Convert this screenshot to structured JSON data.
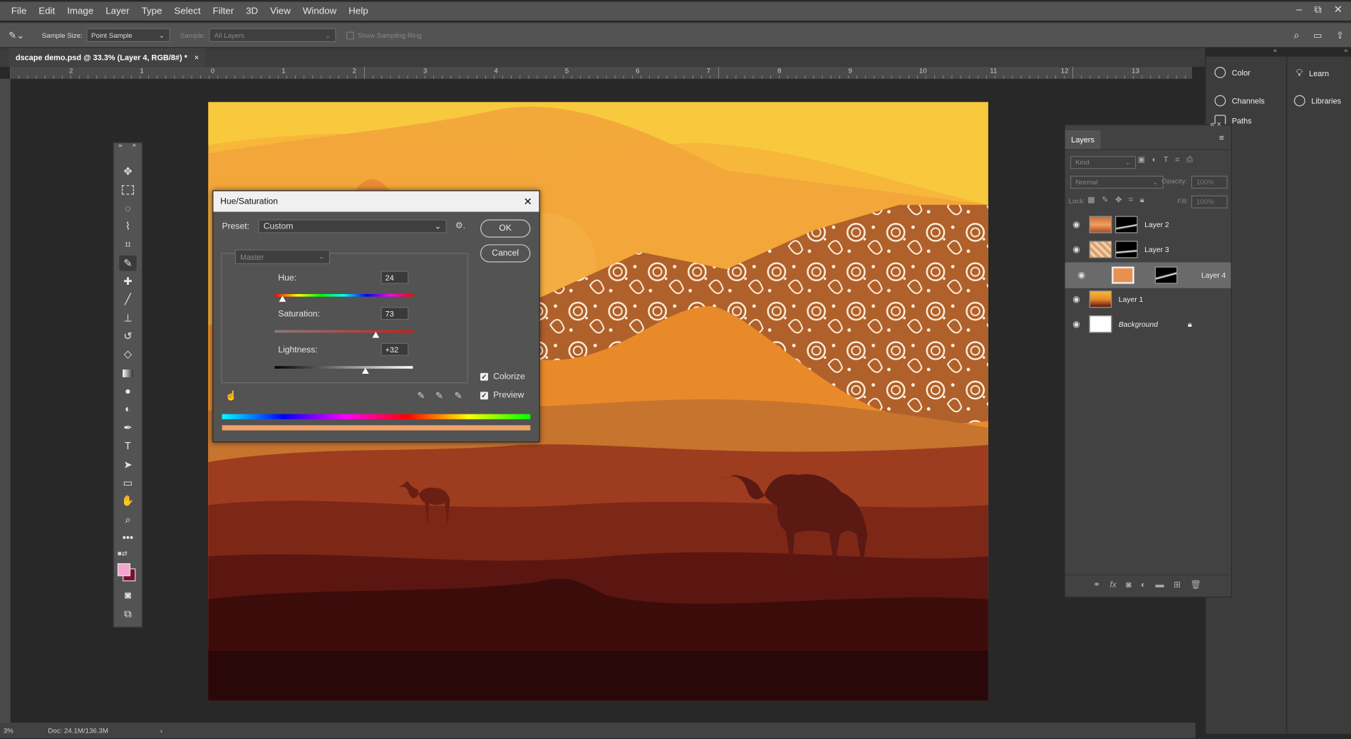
{
  "menu": [
    "File",
    "Edit",
    "Image",
    "Layer",
    "Type",
    "Select",
    "Filter",
    "3D",
    "View",
    "Window",
    "Help"
  ],
  "window_controls": {
    "minimize": "–",
    "restore": "⧉",
    "close": "✕"
  },
  "options_bar": {
    "sample_size_label": "Sample Size:",
    "sample_size_value": "Point Sample",
    "sample_label": "Sample:",
    "sample_value": "All Layers",
    "show_ring_label": "Show Sampling Ring"
  },
  "document_tab": {
    "title": "dscape demo.psd @ 33.3% (Layer 4, RGB/8#) *",
    "close": "×"
  },
  "ruler_labels": [
    "2",
    "1",
    "0",
    "1",
    "2",
    "3",
    "4",
    "5",
    "6",
    "7",
    "8",
    "9",
    "10",
    "11",
    "12",
    "13"
  ],
  "status": {
    "zoom": "3%",
    "doc": "Doc: 24.1M/136.3M",
    "arrow": "›"
  },
  "dialog": {
    "title": "Hue/Saturation",
    "close": "✕",
    "preset_label": "Preset:",
    "preset_value": "Custom",
    "channel": "Master",
    "hue_label": "Hue:",
    "hue_value": "24",
    "saturation_label": "Saturation:",
    "saturation_value": "73",
    "lightness_label": "Lightness:",
    "lightness_value": "+32",
    "ok": "OK",
    "cancel": "Cancel",
    "colorize_label": "Colorize",
    "preview_label": "Preview",
    "colorize_checked": true,
    "preview_checked": true
  },
  "side_panels": {
    "color": "Color",
    "channels": "Channels",
    "paths": "Paths",
    "learn": "Learn",
    "libraries": "Libraries"
  },
  "layers_panel": {
    "title": "Layers",
    "kind": "Kind",
    "blend_mode": "Normal",
    "opacity_label": "Opacity:",
    "opacity_value": "100%",
    "lock_label": "Lock:",
    "fill_label": "Fill:",
    "fill_value": "100%",
    "layers": [
      {
        "name": "Layer 2",
        "selected": false,
        "has_mask": true
      },
      {
        "name": "Layer 3",
        "selected": false,
        "has_mask": true
      },
      {
        "name": "Layer 4",
        "selected": true,
        "has_mask": true
      },
      {
        "name": "Layer 1",
        "selected": false,
        "has_mask": false
      },
      {
        "name": "Background",
        "selected": false,
        "has_mask": false,
        "locked": true
      }
    ],
    "footer_icons": [
      "link-icon",
      "fx-icon",
      "mask-icon",
      "adjustment-icon",
      "folder-icon",
      "new-layer-icon",
      "trash-icon"
    ]
  },
  "tools": [
    "move",
    "marquee",
    "lasso",
    "quick-select",
    "crop",
    "eyedropper",
    "healing",
    "brush",
    "stamp",
    "history-brush",
    "eraser",
    "gradient",
    "blur",
    "dodge",
    "pen",
    "type",
    "path-select",
    "rectangle",
    "hand",
    "zoom",
    "more"
  ],
  "colors": {
    "foreground": "#f3a7cf",
    "background": "#7a1030",
    "accent": "#f2a33a"
  }
}
